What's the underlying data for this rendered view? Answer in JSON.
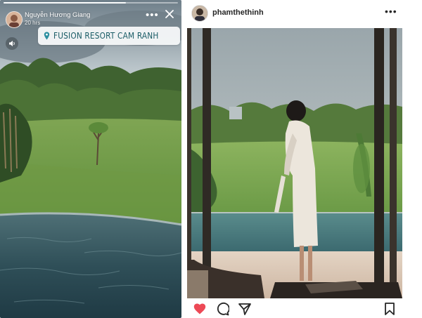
{
  "story": {
    "username": "Nguyễn Hương Giang",
    "time_ago": "20 hrs",
    "location": "FUSION RESORT CAM RANH",
    "progress": 0.7
  },
  "post": {
    "username": "phamthethinh"
  },
  "icons": {
    "story_more": "more-horizontal-icon",
    "story_close": "close-icon",
    "location": "location-pin-icon",
    "sound": "speaker-icon",
    "post_more": "more-horizontal-icon",
    "like": "heart-filled-icon",
    "comment": "comment-icon",
    "share": "paper-plane-icon",
    "save": "bookmark-icon"
  },
  "colors": {
    "like": "#ed4956",
    "location_text": "#1a5c66",
    "username": "#262626"
  }
}
